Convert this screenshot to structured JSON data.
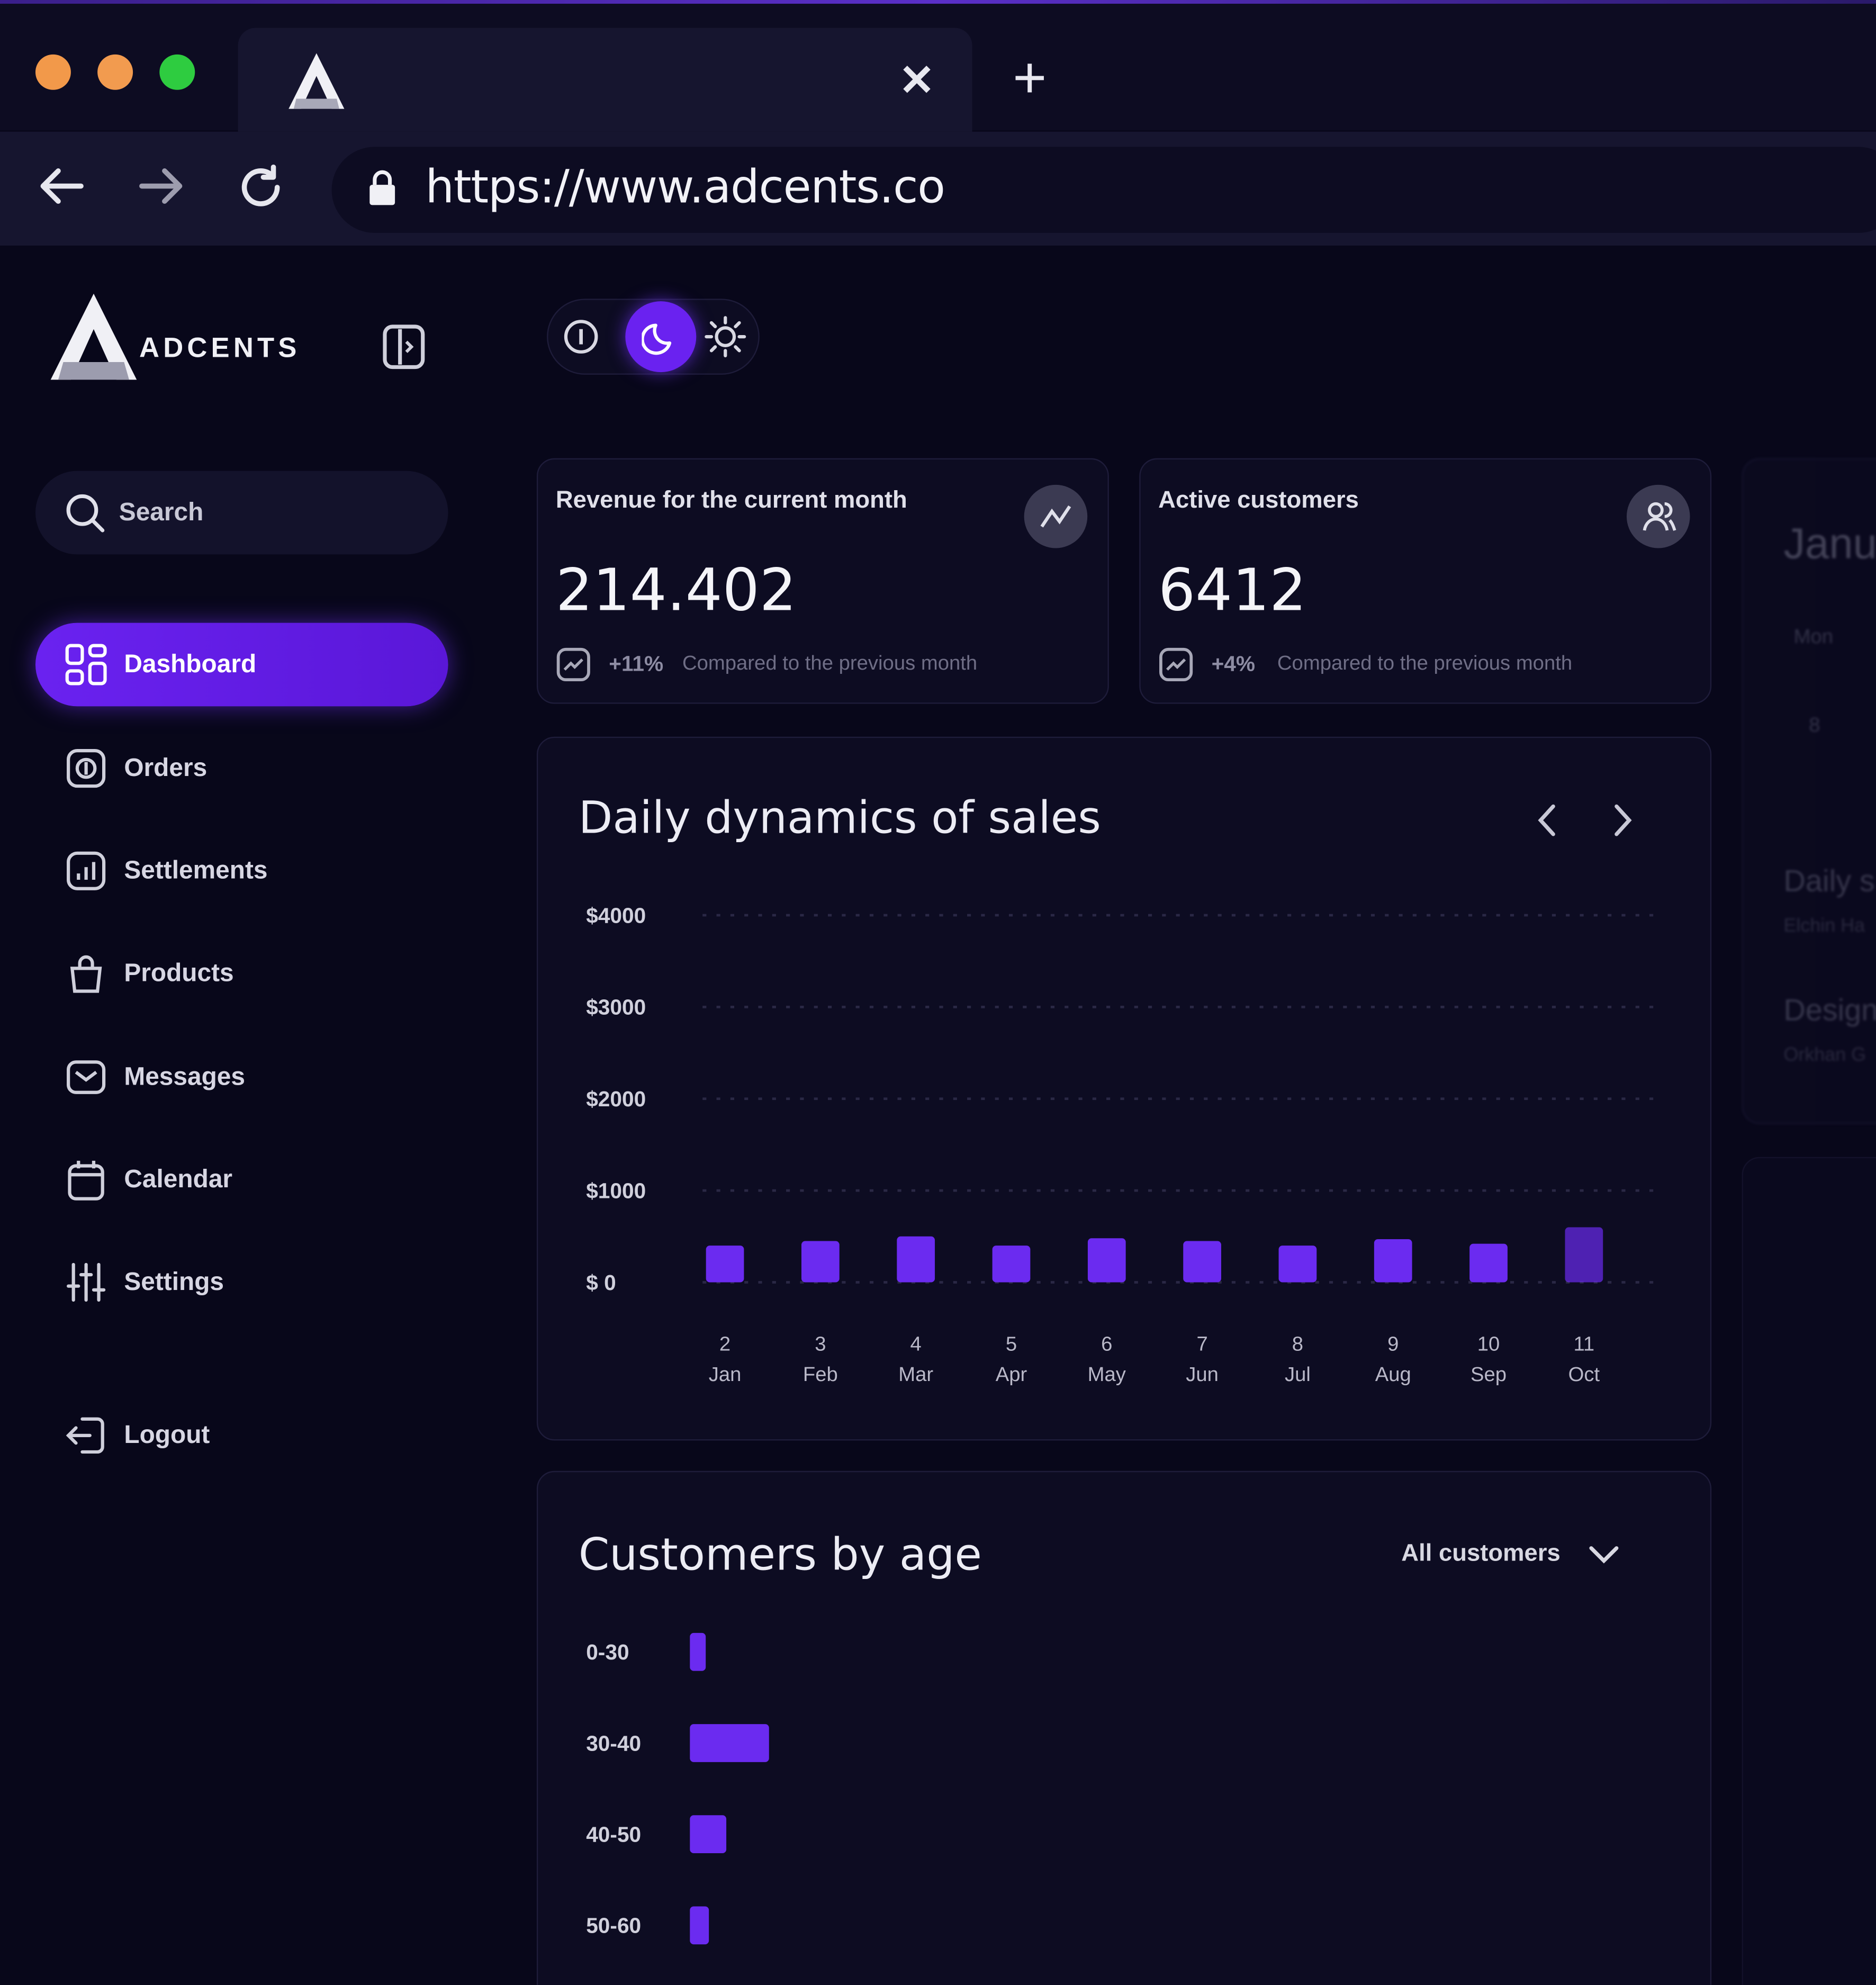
{
  "browser": {
    "url": "https://www.adcents.co",
    "tab_close": "✕",
    "new_tab": "+"
  },
  "brand": {
    "name": "ADCENTS"
  },
  "sidebar": {
    "search_placeholder": "Search",
    "items": [
      {
        "label": "Dashboard",
        "icon": "dashboard-icon",
        "active": true
      },
      {
        "label": "Orders",
        "icon": "orders-icon"
      },
      {
        "label": "Settlements",
        "icon": "settlements-icon"
      },
      {
        "label": "Products",
        "icon": "products-icon"
      },
      {
        "label": "Messages",
        "icon": "messages-icon"
      },
      {
        "label": "Calendar",
        "icon": "calendar-icon"
      },
      {
        "label": "Settings",
        "icon": "settings-icon"
      }
    ],
    "logout": "Logout"
  },
  "stats": [
    {
      "title": "Revenue for the current month",
      "value": "214.402",
      "change": "+11%",
      "note": "Compared to the previous month"
    },
    {
      "title": "Active customers",
      "value": "6412",
      "change": "+4%",
      "note": "Compared to the previous month"
    }
  ],
  "sales_chart": {
    "title": "Daily dynamics of sales",
    "chart_data": {
      "type": "bar",
      "categories": [
        "2 Jan",
        "3 Feb",
        "4 Mar",
        "5 Apr",
        "6 May",
        "7 Jun",
        "8 Jul",
        "9 Aug",
        "10 Sep",
        "11 Oct"
      ],
      "day_labels": [
        "2",
        "3",
        "4",
        "5",
        "6",
        "7",
        "8",
        "9",
        "10",
        "11"
      ],
      "month_labels": [
        "Jan",
        "Feb",
        "Mar",
        "Apr",
        "May",
        "Jun",
        "Jul",
        "Aug",
        "Sep",
        "Oct"
      ],
      "values": [
        400,
        450,
        500,
        400,
        480,
        450,
        400,
        470,
        420,
        600
      ],
      "ylim": [
        0,
        4000
      ],
      "yticks": [
        "$4000",
        "$3000",
        "$2000",
        "$1000",
        "$ 0"
      ],
      "bar_color": "#6b2bf0",
      "grid": true
    }
  },
  "age_chart": {
    "title": "Customers by age",
    "filter": "All customers",
    "chart_data": {
      "type": "bar",
      "orientation": "horizontal",
      "categories": [
        "0-30",
        "30-40",
        "40-50",
        "50-60"
      ],
      "values": [
        1,
        5,
        2.3,
        1.2
      ],
      "bar_color": "#6b2bf0"
    }
  },
  "right_panel": {
    "month": "Janu",
    "weekday": "Mon",
    "day": "8",
    "item1_title": "Daily s",
    "item1_sub": "Elchin Ha",
    "item2_title": "Design",
    "item2_sub": "Orkhan G"
  },
  "colors": {
    "accent": "#6b2bf0",
    "background": "#08071a",
    "card": "#0d0c22"
  }
}
